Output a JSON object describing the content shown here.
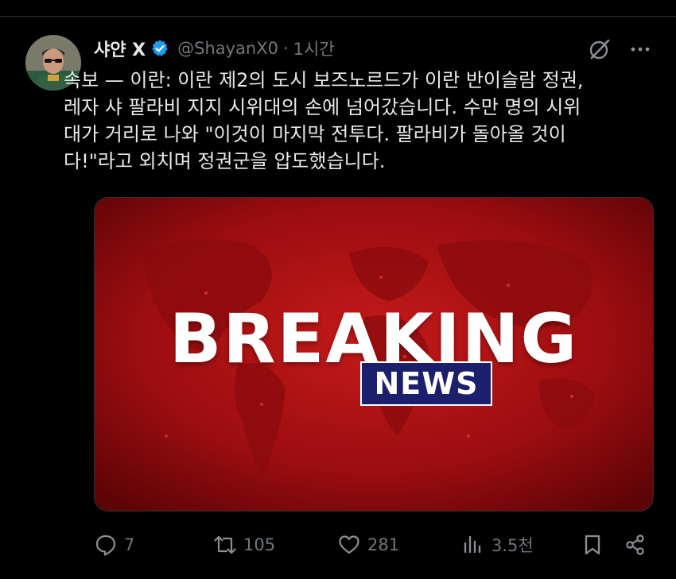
{
  "tweet": {
    "author_name": "샤얀 X",
    "handle": "@ShayanX0",
    "separator": "·",
    "timestamp": "1시간",
    "text": "속보 — 이란: 이란 제2의 도시 보즈노르드가 이란 반이슬람 정권,\n레자 샤 팔라비 지지 시위대의 손에 넘어갔습니다. 수만 명의 시위\n대가 거리로 나와 \"이것이 마지막 전투다. 팔라비가 돌아올 것이\n다!\"라고 외치며 정권군을 압도했습니다.",
    "verified_icon": "verified-badge-icon",
    "verified_color": "#1d9bf0"
  },
  "media": {
    "headline": "BREAKING",
    "subheadline": "NEWS",
    "background_color": "#a30e12",
    "news_box_color": "#1c1f6b"
  },
  "actions": {
    "replies": "7",
    "retweets": "105",
    "likes": "281",
    "views": "3.5천"
  },
  "colors": {
    "background": "#000000",
    "text": "#e7e9ea",
    "muted": "#71767b"
  }
}
